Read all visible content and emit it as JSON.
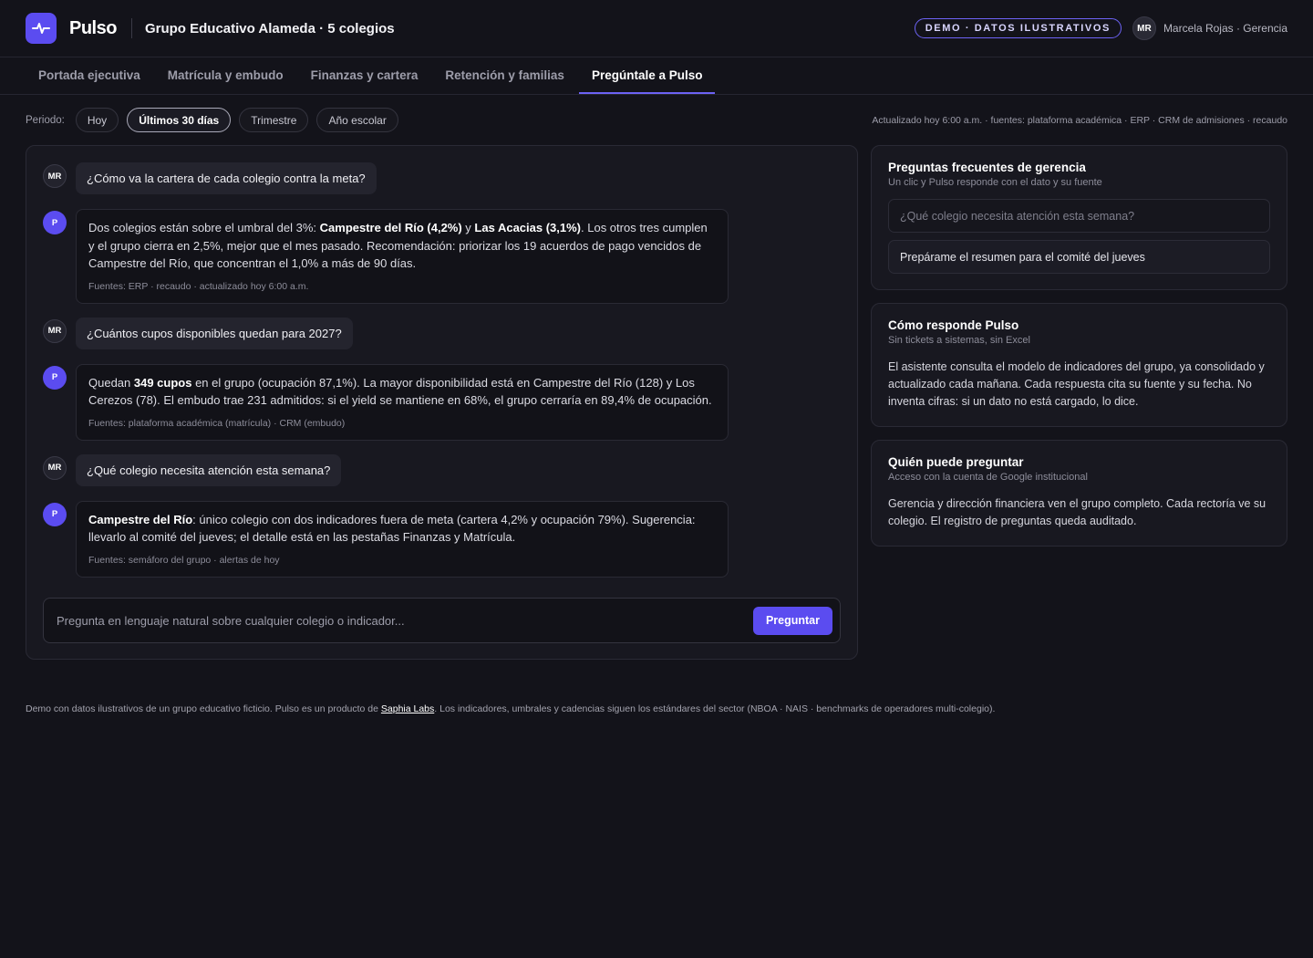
{
  "header": {
    "brand": "Pulso",
    "org_name": "Grupo Educativo Alameda",
    "org_sub": "· 5 colegios",
    "badge": "DEMO · DATOS ILUSTRATIVOS",
    "avatar": "MR",
    "user": "Marcela Rojas · Gerencia"
  },
  "tabs": [
    {
      "label": "Portada ejecutiva"
    },
    {
      "label": "Matrícula y embudo"
    },
    {
      "label": "Finanzas y cartera"
    },
    {
      "label": "Retención y familias"
    },
    {
      "label": "Pregúntale a Pulso",
      "active": true
    }
  ],
  "filters": {
    "label": "Periodo:",
    "options": [
      "Hoy",
      "Últimos 30 días",
      "Trimestre",
      "Año escolar"
    ],
    "selected": "Últimos 30 días",
    "updated": "Actualizado hoy 6:00 a.m. · fuentes: plataforma académica · ERP · CRM de admisiones · recaudo"
  },
  "chat": {
    "user_initials": "MR",
    "bot_initial": "P",
    "q1": "¿Cómo va la cartera de cada colegio contra la meta?",
    "a1": {
      "t1": "Dos colegios están sobre el umbral del 3%: ",
      "b1": "Campestre del Río (4,2%)",
      "t2": " y ",
      "b2": "Las Acacias (3,1%)",
      "t3": ". Los otros tres cumplen y el grupo cierra en 2,5%, mejor que el mes pasado. Recomendación: priorizar los 19 acuerdos de pago vencidos de Campestre del Río, que concentran el 1,0% a más de 90 días.",
      "sources": "Fuentes: ERP · recaudo · actualizado hoy 6:00 a.m."
    },
    "q2": "¿Cuántos cupos disponibles quedan para 2027?",
    "a2": {
      "t1": "Quedan ",
      "b1": "349 cupos",
      "t2": " en el grupo (ocupación 87,1%). La mayor disponibilidad está en Campestre del Río (128) y Los Cerezos (78). El embudo trae 231 admitidos: si el yield se mantiene en 68%, el grupo cerraría en 89,4% de ocupación.",
      "sources": "Fuentes: plataforma académica (matrícula) · CRM (embudo)"
    },
    "q3": "¿Qué colegio necesita atención esta semana?",
    "a3": {
      "b1": "Campestre del Río",
      "t1": ": único colegio con dos indicadores fuera de meta (cartera 4,2% y ocupación 79%). Sugerencia: llevarlo al comité del jueves; el detalle está en las pestañas Finanzas y Matrícula.",
      "sources": "Fuentes: semáforo del grupo · alertas de hoy"
    },
    "input_placeholder": "Pregunta en lenguaje natural sobre cualquier colegio o indicador...",
    "ask_label": "Preguntar"
  },
  "side": {
    "faq": {
      "title": "Preguntas frecuentes de gerencia",
      "subtitle": "Un clic y Pulso responde con el dato y su fuente",
      "items": [
        "¿Qué colegio necesita atención esta semana?",
        "Prepárame el resumen para el comité del jueves"
      ]
    },
    "how": {
      "title": "Cómo responde Pulso",
      "subtitle": "Sin tickets a sistemas, sin Excel",
      "body": "El asistente consulta el modelo de indicadores del grupo, ya consolidado y actualizado cada mañana. Cada respuesta cita su fuente y su fecha. No inventa cifras: si un dato no está cargado, lo dice."
    },
    "who": {
      "title": "Quién puede preguntar",
      "subtitle": "Acceso con la cuenta de Google institucional",
      "body": "Gerencia y dirección financiera ven el grupo completo. Cada rectoría ve su colegio. El registro de preguntas queda auditado."
    }
  },
  "footer": {
    "t1": "Demo con datos ilustrativos de un grupo educativo ficticio. Pulso es un producto de ",
    "link": "Saphia Labs",
    "t2": ". Los indicadores, umbrales y cadencias siguen los estándares del sector (NBOA · NAIS · benchmarks de operadores multi-colegio)."
  },
  "colors": {
    "accent": "#5b4cf0",
    "background": "#13131a"
  }
}
